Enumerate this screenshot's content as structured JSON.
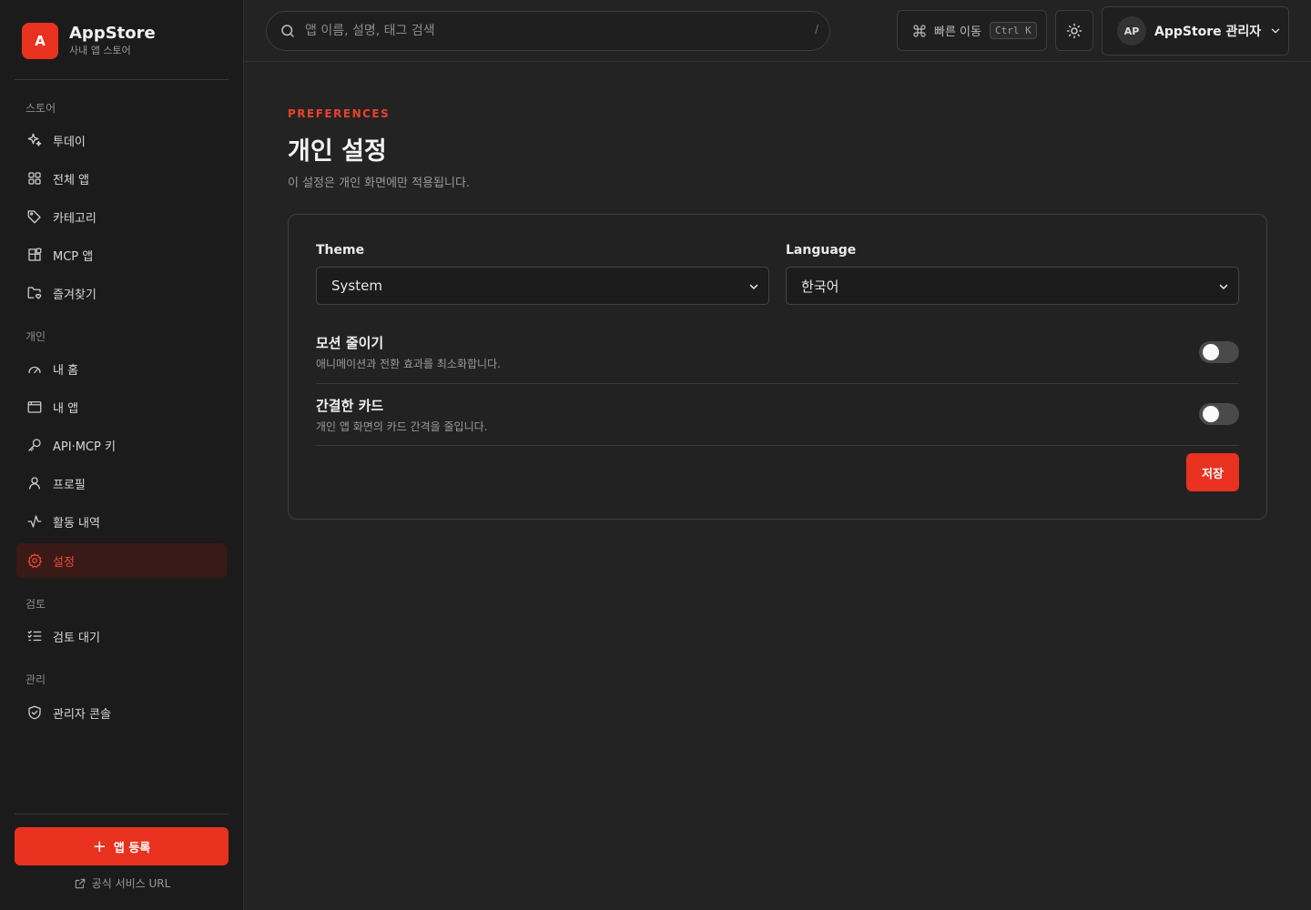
{
  "brand": {
    "logo_letter": "A",
    "title": "AppStore",
    "subtitle": "사내 앱 스토어"
  },
  "sidebar": {
    "sections": {
      "store": "스토어",
      "personal": "개인",
      "review": "검토",
      "admin": "관리"
    },
    "items": [
      {
        "label": "투데이",
        "icon": "sparkles-icon"
      },
      {
        "label": "전체 앱",
        "icon": "grid-icon"
      },
      {
        "label": "카테고리",
        "icon": "tag-icon"
      },
      {
        "label": "MCP 앱",
        "icon": "blocks-icon"
      },
      {
        "label": "즐겨찾기",
        "icon": "folder-heart-icon"
      },
      {
        "label": "내 홈",
        "icon": "gauge-icon"
      },
      {
        "label": "내 앱",
        "icon": "window-icon"
      },
      {
        "label": "API·MCP 키",
        "icon": "key-icon"
      },
      {
        "label": "프로필",
        "icon": "user-icon"
      },
      {
        "label": "활동 내역",
        "icon": "activity-icon"
      },
      {
        "label": "설정",
        "icon": "gear-icon",
        "active": true
      },
      {
        "label": "검토 대기",
        "icon": "checklist-icon"
      },
      {
        "label": "관리자 콘솔",
        "icon": "shield-icon"
      }
    ],
    "add_button": "앱 등록",
    "external_link": "공식 서비스 URL"
  },
  "topbar": {
    "search_placeholder": "앱 이름, 설명, 태그 검색",
    "search_shortcut": "/",
    "quick_nav": "빠른 이동",
    "quick_nav_kbd": "Ctrl K",
    "user_initials": "AP",
    "user_name": "AppStore 관리자"
  },
  "main": {
    "eyebrow": "PREFERENCES",
    "title": "개인 설정",
    "description": "이 설정은 개인 화면에만 적용됩니다.",
    "theme_label": "Theme",
    "theme_value": "System",
    "language_label": "Language",
    "language_value": "한국어",
    "reduce_motion_title": "모션 줄이기",
    "reduce_motion_desc": "애니메이션과 전환 효과를 최소화합니다.",
    "reduce_motion_on": false,
    "compact_cards_title": "간결한 카드",
    "compact_cards_desc": "개인 앱 화면의 카드 간격을 줄입니다.",
    "compact_cards_on": false,
    "save_button": "저장"
  },
  "colors": {
    "accent": "#e8321f",
    "background": "#232323",
    "sidebar": "#1b1b1b"
  }
}
